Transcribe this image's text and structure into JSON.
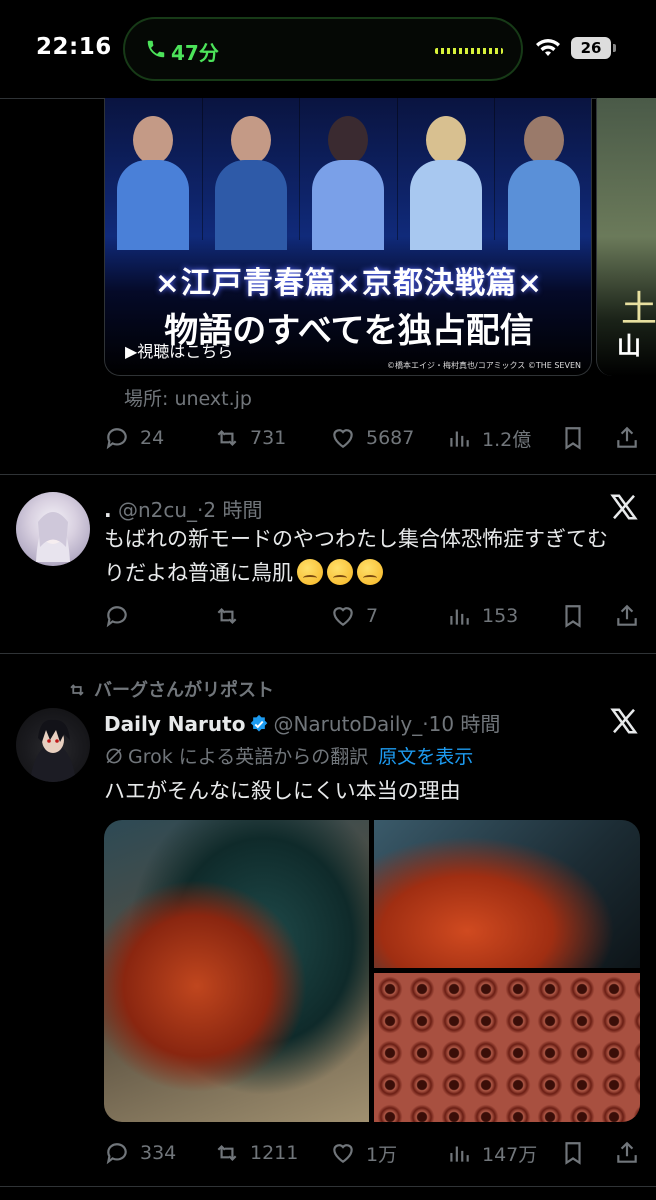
{
  "status_bar": {
    "time": "22:16",
    "call_duration": "47分",
    "battery": "26"
  },
  "card1": {
    "image_subtitle": "×江戸青春篇×京都決戦篇×",
    "image_title": "物語のすべてを独占配信",
    "image_link": "▶視聴はこちら",
    "image_copyright": "©橋本エイジ・梅村真也/コアミックス ©THE SEVEN",
    "location": "場所: unext.jp",
    "stats": {
      "replies": "24",
      "reposts": "731",
      "likes": "5687",
      "views": "1.2億"
    }
  },
  "tweet2": {
    "name": ".",
    "handle": "@n2cu_",
    "time": "·2 時間",
    "text": "もばれの新モードのやつわたし集合体恐怖症すぎてむりだよね普通に鳥肌",
    "emoji": [
      "confounded-face",
      "confounded-face",
      "confounded-face"
    ],
    "stats": {
      "replies": "",
      "reposts": "",
      "likes": "7",
      "views": "153"
    }
  },
  "tweet3": {
    "reposted_by": "バーグさんがリポスト",
    "name": "Daily Naruto",
    "handle": "@NarutoDaily_",
    "time": "·10 時間",
    "translation_note": "Grok による英語からの翻訳",
    "show_original": "原文を表示",
    "text": "ハエがそんなに殺しにくい本当の理由",
    "stats": {
      "replies": "334",
      "reposts": "1211",
      "likes": "1万",
      "views": "147万"
    }
  },
  "colors": {
    "background": "#000000",
    "text": "#e7e9ea",
    "secondary": "#71767b",
    "link": "#1d9bf0",
    "call_green": "#4ce35a"
  }
}
